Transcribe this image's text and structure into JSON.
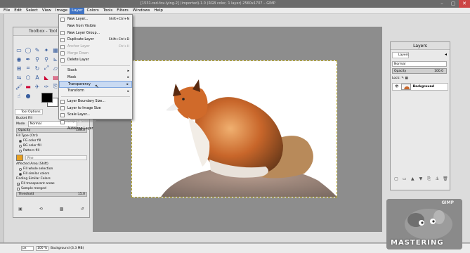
{
  "window": {
    "title": "[1531-red-fox-lying-2] (imported)-1.0 (RGB color, 1 layer) 2560x1707 – GIMP",
    "controls": [
      "minimize-icon",
      "maximize-icon",
      "close-icon"
    ]
  },
  "menubar": {
    "items": [
      "File",
      "Edit",
      "Select",
      "View",
      "Image",
      "Layer",
      "Colors",
      "Tools",
      "Filters",
      "Windows",
      "Help"
    ],
    "active": "Layer"
  },
  "layer_menu": {
    "items": [
      {
        "label": "New Layer...",
        "shortcut": "Shift+Ctrl+N",
        "enabled": true
      },
      {
        "label": "New from Visible",
        "shortcut": "",
        "enabled": true
      },
      {
        "label": "New Layer Group...",
        "shortcut": "",
        "enabled": true
      },
      {
        "label": "Duplicate Layer",
        "shortcut": "Shift+Ctrl+D",
        "enabled": true
      },
      {
        "label": "Anchor Layer",
        "shortcut": "Ctrl+H",
        "enabled": false
      },
      {
        "label": "Merge Down",
        "shortcut": "",
        "enabled": false
      },
      {
        "label": "Delete Layer",
        "shortcut": "",
        "enabled": true
      },
      {
        "label": "Stack",
        "submenu": true,
        "enabled": true
      },
      {
        "label": "Mask",
        "submenu": true,
        "enabled": true
      },
      {
        "label": "Transparency",
        "submenu": true,
        "enabled": true,
        "highlighted": true
      },
      {
        "label": "Transform",
        "submenu": true,
        "enabled": true
      },
      {
        "label": "Layer Boundary Size...",
        "enabled": true
      },
      {
        "label": "Layer to Image Size",
        "enabled": true
      },
      {
        "label": "Scale Layer...",
        "enabled": true
      },
      {
        "label": "Crop to Selection",
        "enabled": false
      },
      {
        "label": "Autocrop Layer",
        "enabled": true
      }
    ]
  },
  "toolbox": {
    "title": "Toolbox - Tool Options",
    "tool_options_tab": "Tool Options",
    "tool_name": "Bucket Fill",
    "mode_label": "Mode",
    "mode_value": "Normal",
    "opacity_label": "Opacity",
    "opacity_value": "100.0",
    "fill_type_label": "Fill Type (Ctrl)",
    "fill_types": [
      "FG color fill",
      "BG color fill",
      "Pattern fill"
    ],
    "fill_type_selected": 0,
    "pattern_name": "Pine",
    "affected_area_label": "Affected Area (Shift)",
    "affected_areas": [
      "Fill whole selection",
      "Fill similar colors"
    ],
    "affected_area_selected": 1,
    "finding_label": "Finding Similar Colors",
    "fill_transparent": "Fill transparent areas",
    "sample_merged": "Sample merged",
    "threshold_label": "Threshold",
    "threshold_value": "15.0",
    "fg_color": "#000000",
    "bg_color": "#ffffff"
  },
  "layers_dock": {
    "title": "Layers",
    "tab": "Layers",
    "mode_value": "Normal",
    "opacity_label": "Opacity",
    "opacity_value": "100.0",
    "lock_label": "Lock:",
    "layer_name": "Background"
  },
  "statusbar": {
    "unit": "px",
    "zoom": "100 %",
    "info": "Background (3.3 MB)"
  },
  "badge": {
    "gimp_text": "GIMP",
    "word": "MASTERING"
  }
}
